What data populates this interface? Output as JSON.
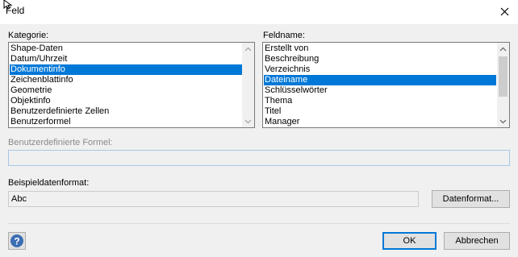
{
  "window": {
    "title": "Feld"
  },
  "kategorie": {
    "label": "Kategorie:",
    "items": [
      "Shape-Daten",
      "Datum/Uhrzeit",
      "Dokumentinfo",
      "Zeichenblattinfo",
      "Geometrie",
      "Objektinfo",
      "Benutzerdefinierte Zellen",
      "Benutzerformel"
    ],
    "selected": "Dokumentinfo"
  },
  "feldname": {
    "label": "Feldname:",
    "items": [
      "Erstellt von",
      "Beschreibung",
      "Verzeichnis",
      "Dateiname",
      "Schlüsselwörter",
      "Thema",
      "Titel",
      "Manager"
    ],
    "selected": "Dateiname"
  },
  "formel": {
    "label": "Benutzerdefinierte Formel:",
    "value": ""
  },
  "beispiel": {
    "label": "Beispieldatenformat:",
    "value": "Abc",
    "format_button": "Datenformat..."
  },
  "footer": {
    "ok_label": "OK",
    "cancel_label": "Abbrechen"
  },
  "colors": {
    "selection": "#0078d7",
    "dialog_bg": "#f0f0f0",
    "help_icon": "#3c6eb4"
  },
  "icons": {
    "close": "close-icon",
    "help": "help-icon",
    "cursor": "mouse-cursor-icon"
  }
}
